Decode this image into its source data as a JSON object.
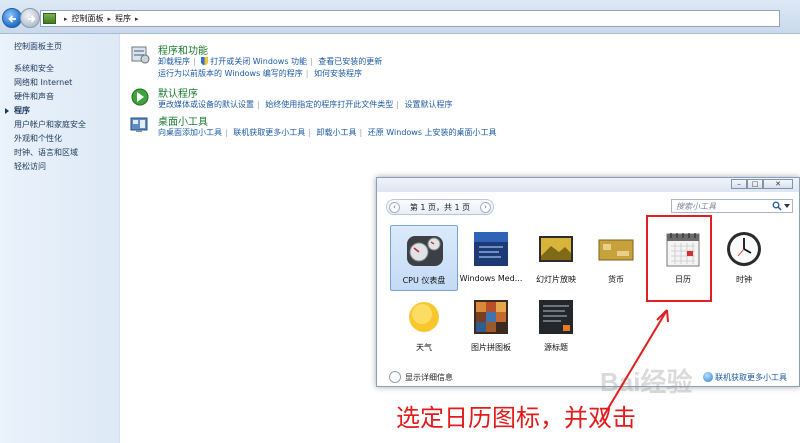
{
  "address_bar": {
    "crumbs": [
      "控制面板",
      "程序"
    ]
  },
  "left_nav": {
    "home": "控制面板主页",
    "items": [
      "系统和安全",
      "网络和 Internet",
      "硬件和声音",
      "程序",
      "用户帐户和家庭安全",
      "外观和个性化",
      "时钟、语言和区域",
      "轻松访问"
    ],
    "current_index": 3
  },
  "sections": [
    {
      "title": "程序和功能",
      "icon": "programs-features-icon",
      "links_line1": [
        "卸载程序",
        "打开或关闭 Windows 功能",
        "查看已安装的更新"
      ],
      "links_line2": [
        "运行为以前版本的 Windows 编写的程序",
        "如何安装程序"
      ]
    },
    {
      "title": "默认程序",
      "icon": "default-programs-icon",
      "links_line1": [
        "更改媒体或设备的默认设置",
        "始终使用指定的程序打开此文件类型",
        "设置默认程序"
      ]
    },
    {
      "title": "桌面小工具",
      "icon": "desktop-gadgets-icon",
      "links_line1": [
        "向桌面添加小工具",
        "联机获取更多小工具",
        "卸载小工具",
        "还原 Windows 上安装的桌面小工具"
      ]
    }
  ],
  "gadget_window": {
    "page_text": "第 1 页，共 1 页",
    "search_placeholder": "搜索小工具",
    "gadgets": [
      "CPU 仪表盘",
      "Windows Med...",
      "幻灯片放映",
      "货币",
      "日历",
      "时钟",
      "天气",
      "图片拼图板",
      "源标题"
    ],
    "selected": "CPU 仪表盘",
    "details_label": "显示详细信息",
    "online_label": "联机获取更多小工具"
  },
  "annotation": {
    "text": "选定日历图标，并双击",
    "color": "#e21b1b"
  },
  "watermark": "Bai经验"
}
